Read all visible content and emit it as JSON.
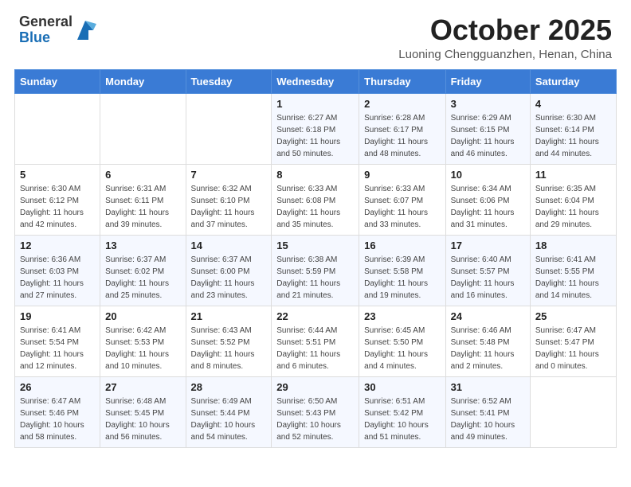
{
  "header": {
    "logo_general": "General",
    "logo_blue": "Blue",
    "month_title": "October 2025",
    "location": "Luoning Chengguanzhen, Henan, China"
  },
  "days_of_week": [
    "Sunday",
    "Monday",
    "Tuesday",
    "Wednesday",
    "Thursday",
    "Friday",
    "Saturday"
  ],
  "weeks": [
    [
      {
        "day": "",
        "info": ""
      },
      {
        "day": "",
        "info": ""
      },
      {
        "day": "",
        "info": ""
      },
      {
        "day": "1",
        "info": "Sunrise: 6:27 AM\nSunset: 6:18 PM\nDaylight: 11 hours\nand 50 minutes."
      },
      {
        "day": "2",
        "info": "Sunrise: 6:28 AM\nSunset: 6:17 PM\nDaylight: 11 hours\nand 48 minutes."
      },
      {
        "day": "3",
        "info": "Sunrise: 6:29 AM\nSunset: 6:15 PM\nDaylight: 11 hours\nand 46 minutes."
      },
      {
        "day": "4",
        "info": "Sunrise: 6:30 AM\nSunset: 6:14 PM\nDaylight: 11 hours\nand 44 minutes."
      }
    ],
    [
      {
        "day": "5",
        "info": "Sunrise: 6:30 AM\nSunset: 6:12 PM\nDaylight: 11 hours\nand 42 minutes."
      },
      {
        "day": "6",
        "info": "Sunrise: 6:31 AM\nSunset: 6:11 PM\nDaylight: 11 hours\nand 39 minutes."
      },
      {
        "day": "7",
        "info": "Sunrise: 6:32 AM\nSunset: 6:10 PM\nDaylight: 11 hours\nand 37 minutes."
      },
      {
        "day": "8",
        "info": "Sunrise: 6:33 AM\nSunset: 6:08 PM\nDaylight: 11 hours\nand 35 minutes."
      },
      {
        "day": "9",
        "info": "Sunrise: 6:33 AM\nSunset: 6:07 PM\nDaylight: 11 hours\nand 33 minutes."
      },
      {
        "day": "10",
        "info": "Sunrise: 6:34 AM\nSunset: 6:06 PM\nDaylight: 11 hours\nand 31 minutes."
      },
      {
        "day": "11",
        "info": "Sunrise: 6:35 AM\nSunset: 6:04 PM\nDaylight: 11 hours\nand 29 minutes."
      }
    ],
    [
      {
        "day": "12",
        "info": "Sunrise: 6:36 AM\nSunset: 6:03 PM\nDaylight: 11 hours\nand 27 minutes."
      },
      {
        "day": "13",
        "info": "Sunrise: 6:37 AM\nSunset: 6:02 PM\nDaylight: 11 hours\nand 25 minutes."
      },
      {
        "day": "14",
        "info": "Sunrise: 6:37 AM\nSunset: 6:00 PM\nDaylight: 11 hours\nand 23 minutes."
      },
      {
        "day": "15",
        "info": "Sunrise: 6:38 AM\nSunset: 5:59 PM\nDaylight: 11 hours\nand 21 minutes."
      },
      {
        "day": "16",
        "info": "Sunrise: 6:39 AM\nSunset: 5:58 PM\nDaylight: 11 hours\nand 19 minutes."
      },
      {
        "day": "17",
        "info": "Sunrise: 6:40 AM\nSunset: 5:57 PM\nDaylight: 11 hours\nand 16 minutes."
      },
      {
        "day": "18",
        "info": "Sunrise: 6:41 AM\nSunset: 5:55 PM\nDaylight: 11 hours\nand 14 minutes."
      }
    ],
    [
      {
        "day": "19",
        "info": "Sunrise: 6:41 AM\nSunset: 5:54 PM\nDaylight: 11 hours\nand 12 minutes."
      },
      {
        "day": "20",
        "info": "Sunrise: 6:42 AM\nSunset: 5:53 PM\nDaylight: 11 hours\nand 10 minutes."
      },
      {
        "day": "21",
        "info": "Sunrise: 6:43 AM\nSunset: 5:52 PM\nDaylight: 11 hours\nand 8 minutes."
      },
      {
        "day": "22",
        "info": "Sunrise: 6:44 AM\nSunset: 5:51 PM\nDaylight: 11 hours\nand 6 minutes."
      },
      {
        "day": "23",
        "info": "Sunrise: 6:45 AM\nSunset: 5:50 PM\nDaylight: 11 hours\nand 4 minutes."
      },
      {
        "day": "24",
        "info": "Sunrise: 6:46 AM\nSunset: 5:48 PM\nDaylight: 11 hours\nand 2 minutes."
      },
      {
        "day": "25",
        "info": "Sunrise: 6:47 AM\nSunset: 5:47 PM\nDaylight: 11 hours\nand 0 minutes."
      }
    ],
    [
      {
        "day": "26",
        "info": "Sunrise: 6:47 AM\nSunset: 5:46 PM\nDaylight: 10 hours\nand 58 minutes."
      },
      {
        "day": "27",
        "info": "Sunrise: 6:48 AM\nSunset: 5:45 PM\nDaylight: 10 hours\nand 56 minutes."
      },
      {
        "day": "28",
        "info": "Sunrise: 6:49 AM\nSunset: 5:44 PM\nDaylight: 10 hours\nand 54 minutes."
      },
      {
        "day": "29",
        "info": "Sunrise: 6:50 AM\nSunset: 5:43 PM\nDaylight: 10 hours\nand 52 minutes."
      },
      {
        "day": "30",
        "info": "Sunrise: 6:51 AM\nSunset: 5:42 PM\nDaylight: 10 hours\nand 51 minutes."
      },
      {
        "day": "31",
        "info": "Sunrise: 6:52 AM\nSunset: 5:41 PM\nDaylight: 10 hours\nand 49 minutes."
      },
      {
        "day": "",
        "info": ""
      }
    ]
  ]
}
